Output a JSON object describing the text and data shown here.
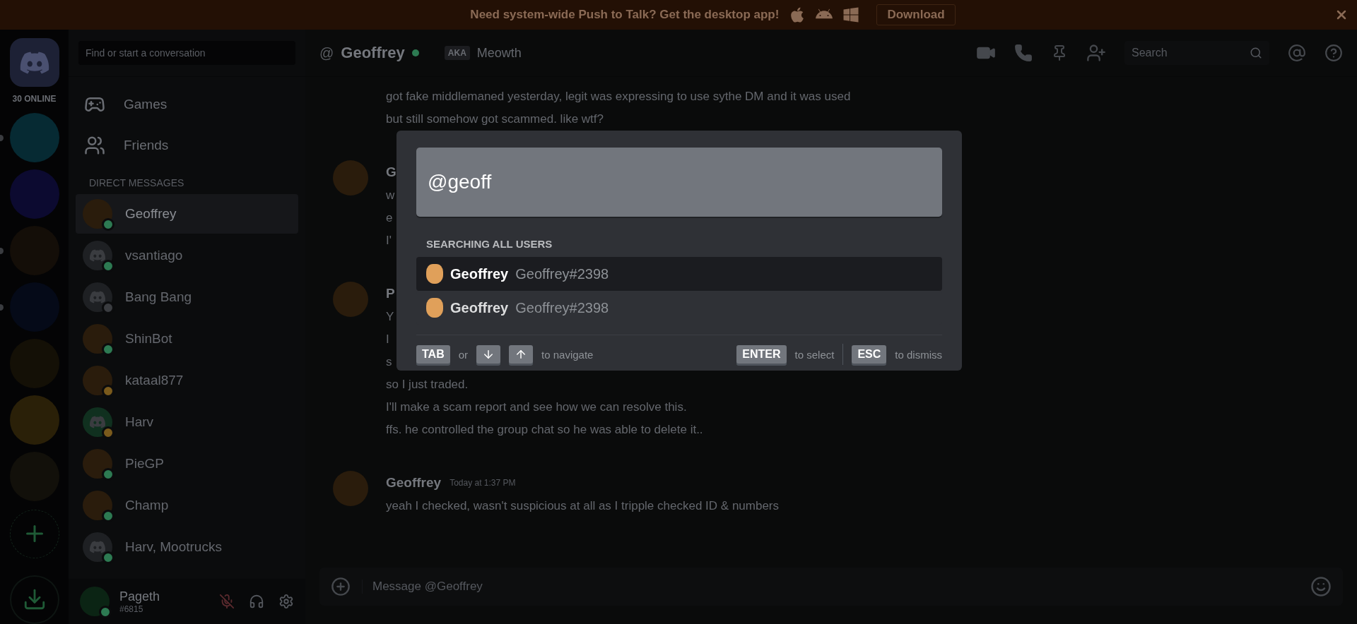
{
  "banner": {
    "text": "Need system-wide Push to Talk? Get the desktop app!",
    "download_label": "Download"
  },
  "servers": {
    "online_label": "30 ONLINE",
    "items": [
      {
        "unread": true
      },
      {
        "unread": false
      },
      {
        "unread": true
      },
      {
        "unread": true
      },
      {
        "unread": false
      },
      {
        "unread": false
      },
      {
        "unread": false
      }
    ]
  },
  "dm": {
    "search_placeholder": "Find or start a conversation",
    "nav": [
      {
        "kind": "games",
        "label": "Games"
      },
      {
        "kind": "friends",
        "label": "Friends"
      }
    ],
    "section_title": "DIRECT MESSAGES",
    "conversations": [
      {
        "name": "Geoffrey",
        "selected": true,
        "kind": "image",
        "color": "#2d7a52"
      },
      {
        "name": "vsantiago",
        "selected": false,
        "kind": "default",
        "color": "#2d7a52"
      },
      {
        "name": "Bang Bang",
        "selected": false,
        "kind": "default",
        "color": "#3a3c40"
      },
      {
        "name": "ShinBot",
        "selected": false,
        "kind": "image",
        "color": "#2d7a52"
      },
      {
        "name": "kataal877",
        "selected": false,
        "kind": "image",
        "color": "#7a5a1c"
      },
      {
        "name": "Harv",
        "selected": false,
        "kind": "default-green",
        "color": "#7a5a1c"
      },
      {
        "name": "PieGP",
        "selected": false,
        "kind": "image",
        "color": "#2d7a52"
      },
      {
        "name": "Champ",
        "selected": false,
        "kind": "image",
        "color": "#2d7a52"
      },
      {
        "name": "Harv, Mootrucks",
        "selected": false,
        "kind": "default",
        "color": "#2d7a52"
      }
    ],
    "user": {
      "name": "Pageth",
      "tag": "#6815",
      "muted": true
    }
  },
  "header": {
    "at": "@",
    "name": "Geoffrey",
    "aka": "AKA",
    "nickname": "Meowth",
    "search_placeholder": "Search"
  },
  "messages": [
    {
      "lines": [
        "got fake middlemaned yesterday, legit was expressing to use sythe DM and it was used",
        "but still somehow got scammed. like wtf?"
      ]
    },
    {
      "author": "G",
      "lines": [
        "w",
        "e",
        "I'"
      ]
    },
    {
      "author": "P",
      "lines": [
        "Y",
        "I",
        "s",
        "so I just traded.",
        "I'll make a scam report and see how we can resolve this.",
        "ffs. he controlled the group chat so he was able to delete it.."
      ]
    },
    {
      "author": "Geoffrey",
      "time": "Today at 1:37 PM",
      "lines": [
        "yeah I checked, wasn't suspicious at all as I tripple checked ID & numbers"
      ]
    }
  ],
  "composer": {
    "placeholder": "Message @Geoffrey"
  },
  "switcher": {
    "query": "@geoff",
    "heading": "SEARCHING ALL USERS",
    "results": [
      {
        "name": "Geoffrey",
        "tag": "Geoffrey#2398",
        "selected": true
      },
      {
        "name": "Geoffrey",
        "tag": "Geoffrey#2398",
        "selected": false
      }
    ],
    "hints_left": [
      {
        "kind": "key",
        "label": "TAB"
      },
      {
        "kind": "text",
        "label": "or"
      },
      {
        "kind": "down"
      },
      {
        "kind": "up"
      },
      {
        "kind": "text",
        "label": "to navigate"
      }
    ],
    "hints_right": [
      {
        "kind": "key",
        "label": "ENTER"
      },
      {
        "kind": "text",
        "label": "to select"
      },
      {
        "kind": "divider"
      },
      {
        "kind": "key",
        "label": "ESC"
      },
      {
        "kind": "text",
        "label": "to dismiss"
      }
    ]
  }
}
